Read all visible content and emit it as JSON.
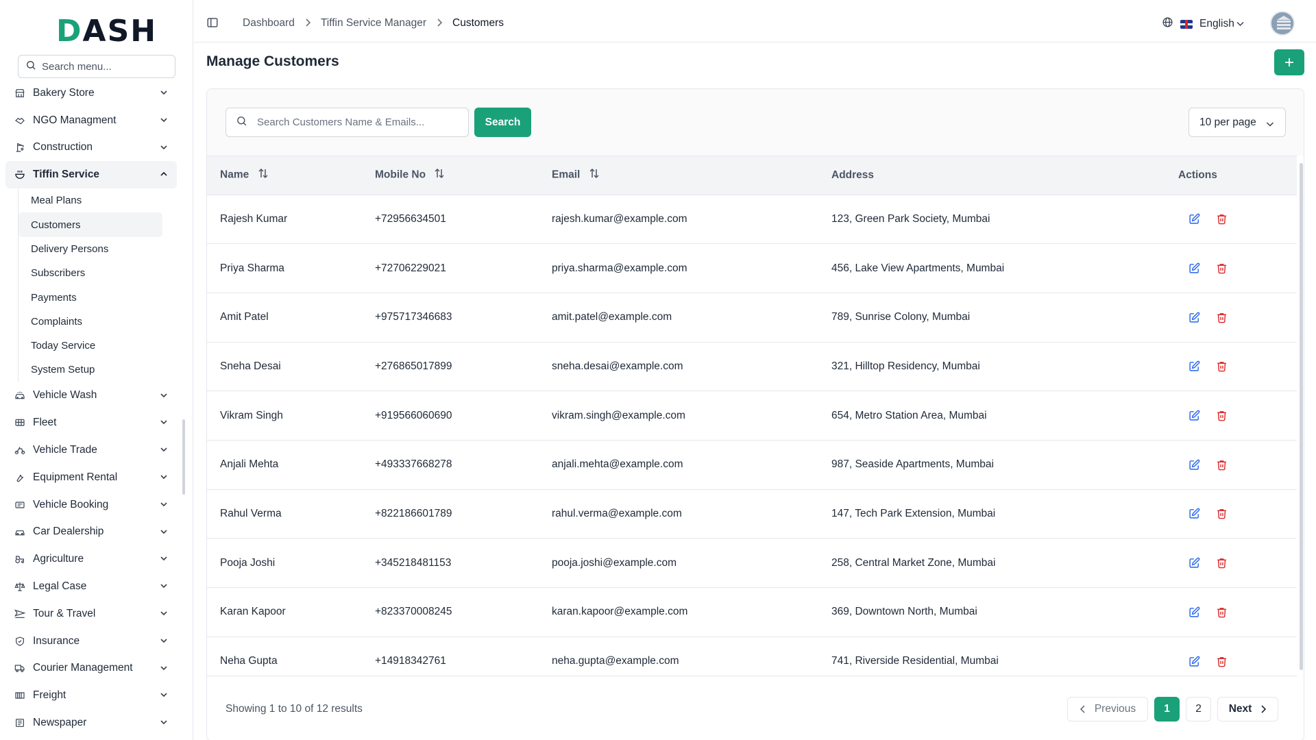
{
  "brand": {
    "logo_text": "DASH",
    "accent": "#1aa179"
  },
  "sidebar": {
    "search_placeholder": "Search menu...",
    "items": [
      {
        "label": "Bakery Store",
        "icon": "store-icon"
      },
      {
        "label": "NGO Managment",
        "icon": "handshake-icon"
      },
      {
        "label": "Construction",
        "icon": "crane-icon"
      },
      {
        "label": "Tiffin Service",
        "icon": "bowl-icon",
        "expanded": true
      },
      {
        "label": "Vehicle Wash",
        "icon": "car-wash-icon"
      },
      {
        "label": "Fleet",
        "icon": "bus-icon"
      },
      {
        "label": "Vehicle Trade",
        "icon": "bike-icon"
      },
      {
        "label": "Equipment Rental",
        "icon": "wrench-icon"
      },
      {
        "label": "Vehicle Booking",
        "icon": "ticket-icon"
      },
      {
        "label": "Car Dealership",
        "icon": "car-icon"
      },
      {
        "label": "Agriculture",
        "icon": "tractor-icon"
      },
      {
        "label": "Legal Case",
        "icon": "scale-icon"
      },
      {
        "label": "Tour & Travel",
        "icon": "plane-icon"
      },
      {
        "label": "Insurance",
        "icon": "shield-icon"
      },
      {
        "label": "Courier Management",
        "icon": "truck-icon"
      },
      {
        "label": "Freight",
        "icon": "container-icon"
      },
      {
        "label": "Newspaper",
        "icon": "newspaper-icon"
      }
    ],
    "tiffin_sub": [
      {
        "label": "Meal Plans"
      },
      {
        "label": "Customers",
        "active": true
      },
      {
        "label": "Delivery Persons"
      },
      {
        "label": "Subscribers"
      },
      {
        "label": "Payments"
      },
      {
        "label": "Complaints"
      },
      {
        "label": "Today Service"
      },
      {
        "label": "System Setup"
      }
    ]
  },
  "header": {
    "breadcrumb": [
      "Dashboard",
      "Tiffin Service Manager",
      "Customers"
    ],
    "language": "English"
  },
  "main": {
    "title": "Manage Customers",
    "search_placeholder": "Search Customers Name & Emails...",
    "search_button": "Search",
    "per_page": "10 per page",
    "columns": [
      "Name",
      "Mobile No",
      "Email",
      "Address",
      "Actions"
    ],
    "rows": [
      {
        "name": "Rajesh Kumar",
        "mobile": "+72956634501",
        "email": "rajesh.kumar@example.com",
        "address": "123, Green Park Society, Mumbai"
      },
      {
        "name": "Priya Sharma",
        "mobile": "+72706229021",
        "email": "priya.sharma@example.com",
        "address": "456, Lake View Apartments, Mumbai"
      },
      {
        "name": "Amit Patel",
        "mobile": "+975717346683",
        "email": "amit.patel@example.com",
        "address": "789, Sunrise Colony, Mumbai"
      },
      {
        "name": "Sneha Desai",
        "mobile": "+276865017899",
        "email": "sneha.desai@example.com",
        "address": "321, Hilltop Residency, Mumbai"
      },
      {
        "name": "Vikram Singh",
        "mobile": "+919566060690",
        "email": "vikram.singh@example.com",
        "address": "654, Metro Station Area, Mumbai"
      },
      {
        "name": "Anjali Mehta",
        "mobile": "+493337668278",
        "email": "anjali.mehta@example.com",
        "address": "987, Seaside Apartments, Mumbai"
      },
      {
        "name": "Rahul Verma",
        "mobile": "+822186601789",
        "email": "rahul.verma@example.com",
        "address": "147, Tech Park Extension, Mumbai"
      },
      {
        "name": "Pooja Joshi",
        "mobile": "+345218481153",
        "email": "pooja.joshi@example.com",
        "address": "258, Central Market Zone, Mumbai"
      },
      {
        "name": "Karan Kapoor",
        "mobile": "+823370008245",
        "email": "karan.kapoor@example.com",
        "address": "369, Downtown North, Mumbai"
      },
      {
        "name": "Neha Gupta",
        "mobile": "+14918342761",
        "email": "neha.gupta@example.com",
        "address": "741, Riverside Residential, Mumbai"
      }
    ],
    "footer_info": "Showing 1 to 10 of 12 results",
    "pagination": {
      "previous": "Previous",
      "next": "Next",
      "pages": [
        "1",
        "2"
      ],
      "current": "1"
    }
  }
}
